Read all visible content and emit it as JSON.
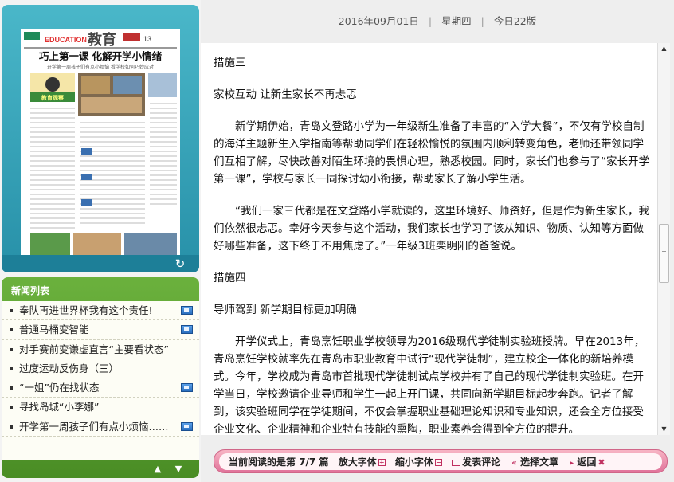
{
  "date_bar": {
    "date": "2016年09月01日",
    "sep": "|",
    "weekday": "星期四",
    "edition": "今日22版"
  },
  "paper_thumbnail": {
    "section_brand": "EDUCATION",
    "section_name": "教育",
    "page_number": "13",
    "headline": "巧上第一课 化解开学小情绪",
    "subheadline": "开学第一周孩子们有点小烦恼 看学校如何巧妙应对",
    "column_label": "教育观察"
  },
  "news_panel": {
    "title": "新闻列表",
    "items": [
      {
        "label": "奉队再进世界杯我有这个责任!",
        "has_media": true
      },
      {
        "label": "普通马桶变智能",
        "has_media": true
      },
      {
        "label": "对手赛前变谦虚直言“主要看状态”",
        "has_media": false
      },
      {
        "label": "过度运动反伤身（三）",
        "has_media": false
      },
      {
        "label": "“一姐”仍在找状态",
        "has_media": true
      },
      {
        "label": "寻找岛城“小李娜”",
        "has_media": false
      },
      {
        "label": "开学第一周孩子们有点小烦恼……",
        "has_media": true
      }
    ]
  },
  "article": {
    "paragraphs": [
      {
        "text": "措施三",
        "indent": false
      },
      {
        "text": "家校互动 让新生家长不再忐忑",
        "indent": false
      },
      {
        "text": "新学期伊始，青岛文登路小学为一年级新生准备了丰富的“入学大餐”，不仅有学校自制的海洋主题新生入学指南等帮助同学们在轻松愉悦的氛围内顺利转变角色，老师还带领同学们互相了解，尽快改善对陌生环境的畏惧心理，熟悉校园。同时，家长们也参与了“家长开学第一课”，学校与家长一同探讨幼小衔接，帮助家长了解小学生活。",
        "indent": true
      },
      {
        "text": "“我们一家三代都是在文登路小学就读的，这里环境好、师资好，但是作为新生家长，我们依然很忐忑。幸好今天参与这个活动，我们家长也学习了该从知识、物质、认知等方面做好哪些准备，这下终于不用焦虑了。”一年级3班栾明阳的爸爸说。",
        "indent": true
      },
      {
        "text": "措施四",
        "indent": false
      },
      {
        "text": "导师驾到 新学期目标更加明确",
        "indent": false
      },
      {
        "text": "开学仪式上，青岛烹饪职业学校领导为2016级现代学徒制实验班授牌。早在2013年，青岛烹饪学校就率先在青岛市职业教育中试行“现代学徒制”，建立校企一体化的新培养模式。今年，学校成为青岛市首批现代学徒制试点学校并有了自己的现代学徒制实验班。在开学当日，学校邀请企业导师和学生一起上开门课，共同向新学期目标起步奔跑。记者了解到，该实验班同学在学徒期间，不仅会掌握职业基础理论知识和专业知识，还会全方位接受企业文化、企业精神和企业特有技能的熏陶，职业素养会得到全方位的提升。",
        "indent": true
      }
    ]
  },
  "bottom_bar": {
    "reading_prefix": "当前阅读的是第",
    "reading_position": "7/7",
    "reading_suffix": "篇",
    "zoom_in": "放大字体",
    "zoom_out": "缩小字体",
    "comment": "发表评论",
    "select_article": "选择文章",
    "back": "返回"
  },
  "colors": {
    "paper_frame": "#2c97af",
    "news_panel": "#5a9f2f",
    "bottom_bar": "#e88aa8",
    "accent_red": "#c03060"
  },
  "icons": {
    "refresh": "refresh-icon",
    "media": "video-icon",
    "nav_up": "up-arrow-icon",
    "nav_down": "down-arrow-icon"
  }
}
